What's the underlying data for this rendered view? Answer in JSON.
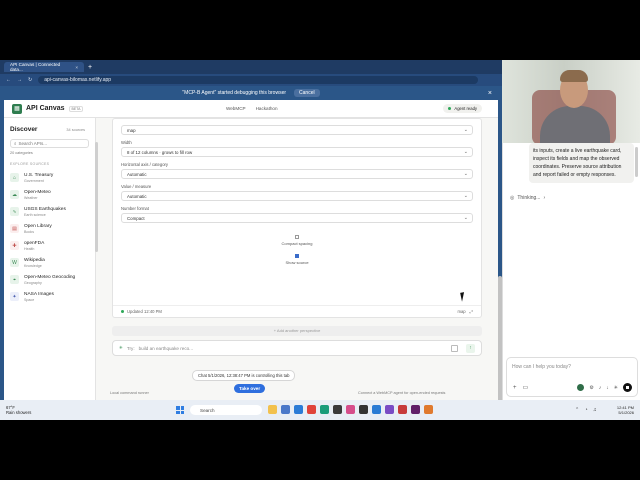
{
  "browser": {
    "tab_title": "API Canvas | Connected data...",
    "tab_close": "×",
    "new_tab": "+",
    "url": "api-canvas-bilomas.netlify.app",
    "debug_message": "\"MCP-B Agent\" started debugging this browser",
    "debug_cancel": "Cancel",
    "debug_close": "×"
  },
  "app": {
    "brand": "API Canvas",
    "beta": "BETA",
    "nav": [
      "WebMCP",
      "Hackathon"
    ],
    "agent_status": "Agent ready"
  },
  "sidebar": {
    "title": "Discover",
    "sources_count": "34 sources",
    "search_placeholder": "Search APIs...",
    "categories": "20 categories",
    "explore_label": "EXPLORE SOURCES",
    "sources": [
      {
        "name": "U.S. Treasury",
        "category": "Government",
        "icon": "bank-icon"
      },
      {
        "name": "Open-Meteo",
        "category": "Weather",
        "icon": "weather-icon"
      },
      {
        "name": "USGS Earthquakes",
        "category": "Earth science",
        "icon": "earthquake-icon"
      },
      {
        "name": "Open Library",
        "category": "Books",
        "icon": "book-icon"
      },
      {
        "name": "openFDA",
        "category": "Health",
        "icon": "health-icon"
      },
      {
        "name": "Wikipedia",
        "category": "Knowledge",
        "icon": "wiki-icon"
      },
      {
        "name": "Open-Meteo Geocoding",
        "category": "Geography",
        "icon": "map-pin-icon"
      },
      {
        "name": "NASA Images",
        "category": "Space",
        "icon": "space-icon"
      }
    ]
  },
  "panel": {
    "field0_value": "map",
    "width_label": "Width",
    "width_value": "8 of 12 columns · grows to fill row",
    "hcat_label": "Horizontal axis / category",
    "hcat_value": "Automatic",
    "value_label": "Value / measure",
    "value_value": "Automatic",
    "numfmt_label": "Number format",
    "numfmt_value": "Compact",
    "compact_spacing": "Compact spacing",
    "compact_spacing_checked": false,
    "show_source": "Show source",
    "show_source_checked": true,
    "updated": "Updated 12:40 PM",
    "view_type": "map"
  },
  "add_perspective": "+ Add another perspective",
  "prompt": {
    "prefix": "Try:",
    "placeholder": "build an earthquake reco..."
  },
  "control_message": "Chat 5/1/2026, 12:38:47 PM is controlling this tab",
  "take_over": "Take over",
  "footer_left": "Local command runner",
  "footer_right": "Connect a WebMCP agent for open-ended requests",
  "chat": {
    "message": "its inputs, create a live earthquake card, inspect its fields and map the observed coordinates. Preserve source attribution and report failed or empty responses.",
    "thinking": "Thinking...",
    "input_placeholder": "How can I help you today?"
  },
  "taskbar": {
    "temp": "67°F",
    "weather": "Rain showers",
    "search": "Search",
    "time": "12:41 PM",
    "date": "5/1/2026"
  }
}
